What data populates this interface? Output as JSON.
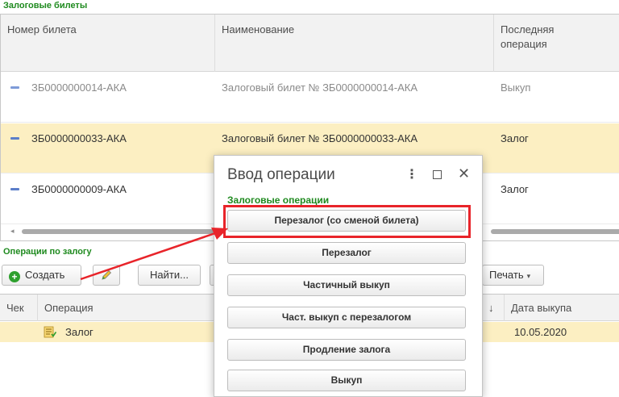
{
  "pledge_tickets": {
    "title": "Залоговые билеты",
    "columns": [
      "Номер билета",
      "Наименование",
      "Последняя операция"
    ],
    "rows": [
      {
        "number": "ЗБ0000000014-АКА",
        "name": "Залоговый билет № ЗБ0000000014-АКА",
        "operation": "Выкуп"
      },
      {
        "number": "ЗБ0000000033-АКА",
        "name": "Залоговый билет № ЗБ0000000033-АКА",
        "operation": "Залог"
      },
      {
        "number": "ЗБ0000000009-АКА",
        "name": "",
        "operation": "Залог"
      }
    ]
  },
  "pledge_operations": {
    "title": "Операции по залогу",
    "toolbar": {
      "create": "Создать",
      "find": "Найти...",
      "print": "Печать"
    },
    "columns": [
      "Чек",
      "Операция",
      "↓",
      "Дата выкупа"
    ],
    "rows": [
      {
        "operation": "Залог",
        "redemption_date": "10.05.2020"
      }
    ]
  },
  "modal": {
    "title": "Ввод операции",
    "group_title": "Залоговые операции",
    "buttons": [
      "Перезалог (со сменой билета)",
      "Перезалог",
      "Частичный выкуп",
      "Част. выкуп с перезалогом",
      "Продление залога",
      "Выкуп"
    ]
  },
  "colors": {
    "accent_green": "#1e8a1e",
    "selected_row": "#fcefc2",
    "highlight_red": "#e8242a"
  },
  "icons": {
    "create": "plus-circle-icon",
    "edit": "pencil-icon",
    "row_marker": "dash-icon",
    "operation": "document-icon",
    "more": "more-vertical-icon",
    "maximize": "maximize-icon",
    "close": "close-icon"
  }
}
